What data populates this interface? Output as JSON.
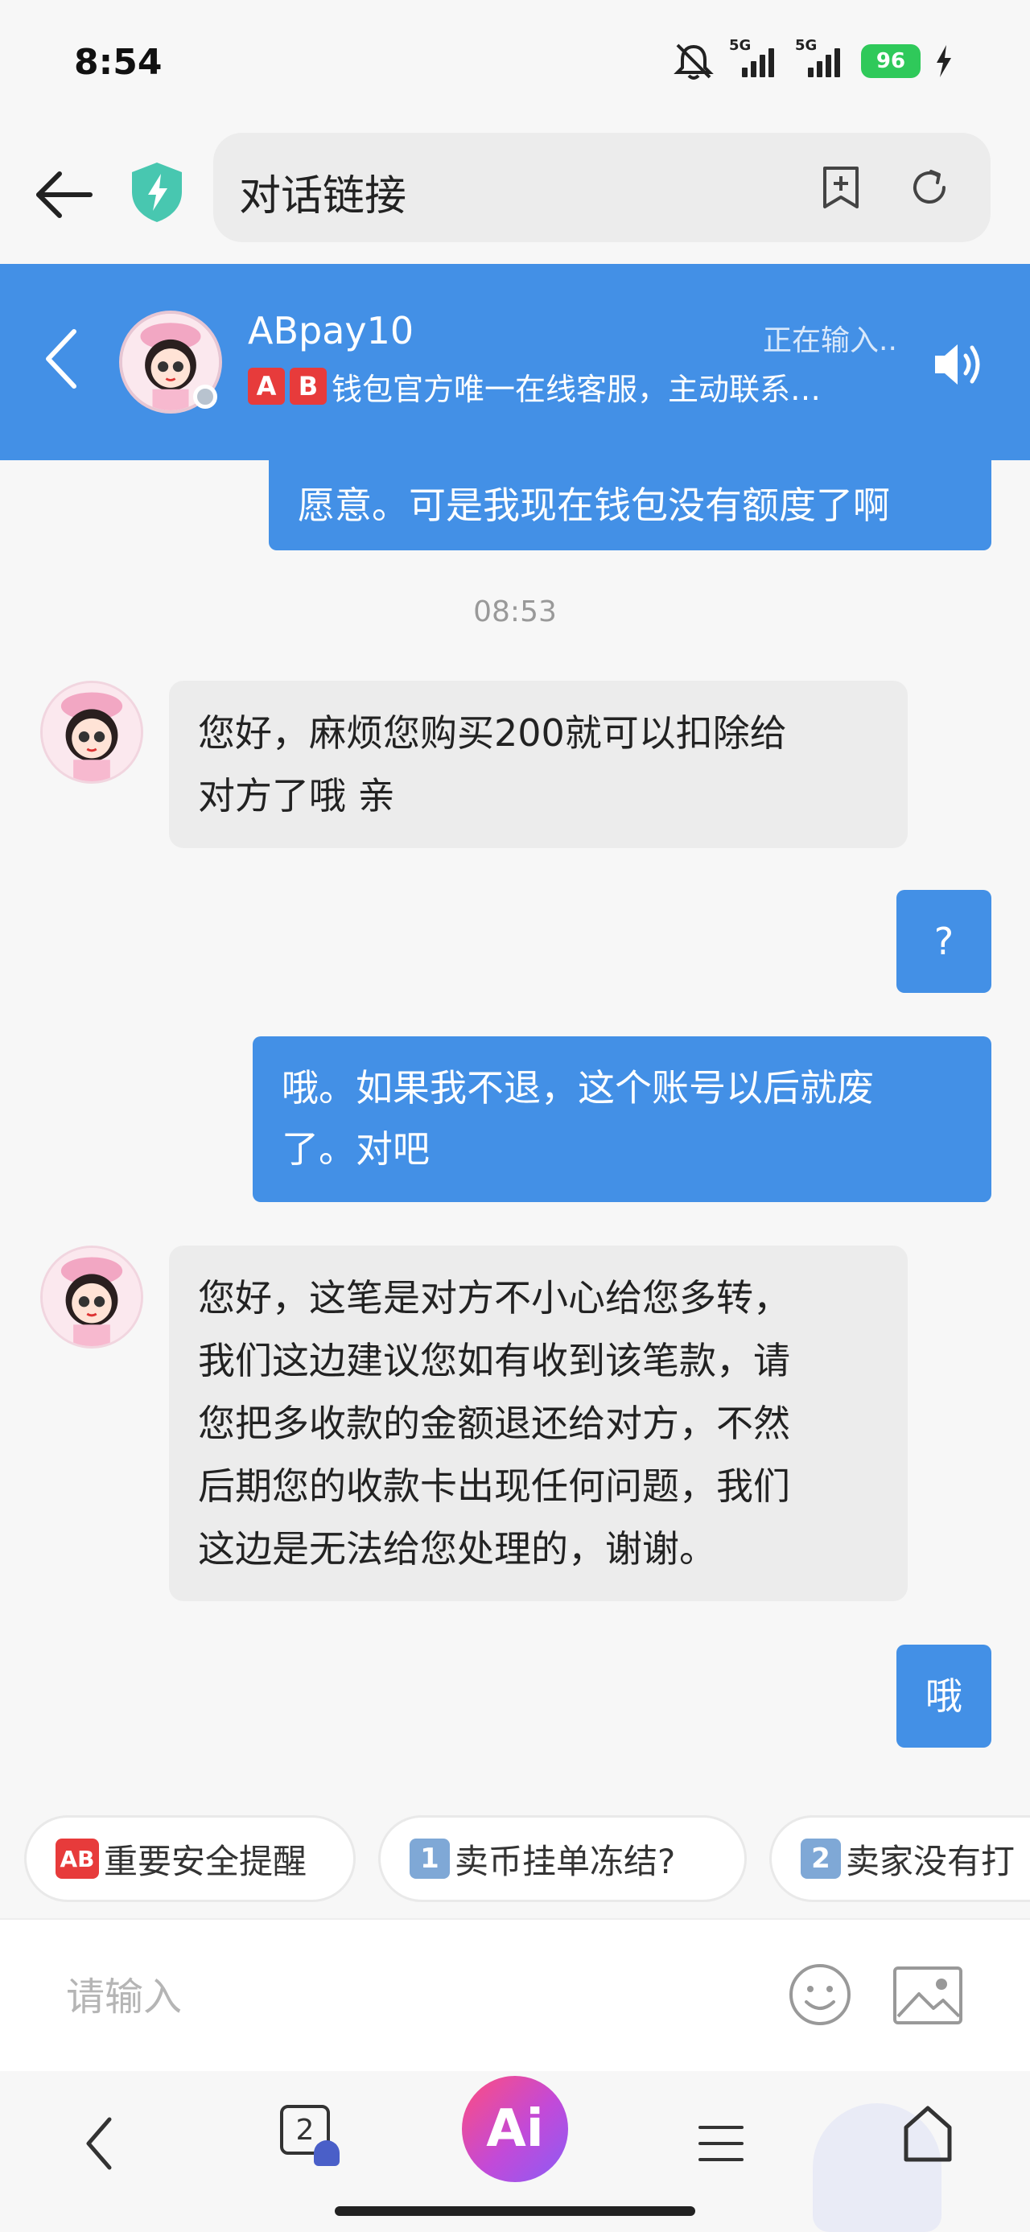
{
  "status_bar": {
    "time": "8:54",
    "network_1": "5G",
    "network_2": "5G",
    "battery": "96"
  },
  "browser": {
    "url_title": "对话链接"
  },
  "chat_header": {
    "agent_name": "ABpay10",
    "typing_status": "正在输入..",
    "badge_a": "A",
    "badge_b": "B",
    "description": "钱包官方唯一在线客服，主动联系…"
  },
  "messages": {
    "m1": "愿意。可是我现在钱包没有额度了啊",
    "timestamp": "08:53",
    "m2_line1": "您好，麻烦您购买200就可以扣除给",
    "m2_line2": "对方了哦 亲",
    "m3": "?",
    "m4_line1": "哦。如果我不退，这个账号以后就废",
    "m4_line2": "了。对吧",
    "m5_line1": "您好，这笔是对方不小心给您多转，",
    "m5_line2": "我们这边建议您如有收到该笔款，请",
    "m5_line3": "您把多收款的金额退还给对方，不然",
    "m5_line4": "后期您的收款卡出现任何问题，我们",
    "m5_line5": "这边是无法给您处理的，谢谢。",
    "m6": "哦"
  },
  "quick_replies": {
    "q1_badge": "AB",
    "q1": "重要安全提醒",
    "q2_badge": "1",
    "q2": "卖币挂单冻结?",
    "q3_badge": "2",
    "q3": "卖家没有打"
  },
  "input": {
    "placeholder": "请输入"
  },
  "bottom_nav": {
    "tabs_count": "2",
    "ai_label": "Ai"
  },
  "colors": {
    "header_blue": "#4390e6",
    "bubble_out": "#4390e6",
    "bubble_in": "#ececec",
    "battery_green": "#2fc95a"
  }
}
